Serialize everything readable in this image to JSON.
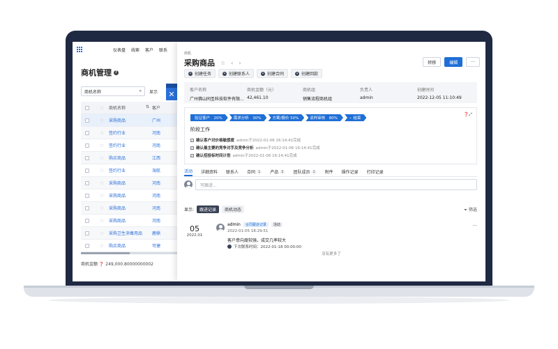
{
  "topnav": {
    "items": [
      "仪表盘",
      "线索",
      "客户",
      "联系"
    ]
  },
  "left": {
    "title": "商机管理",
    "filter_value": "商机名称",
    "show_label": "显示",
    "columns": [
      "商机名称",
      "客户"
    ],
    "rows": [
      {
        "name": "采购商品",
        "customer": "广州"
      },
      {
        "name": "签约行业",
        "customer": "河南"
      },
      {
        "name": "签约行业",
        "customer": "河南"
      },
      {
        "name": "购买商品",
        "customer": "江西"
      },
      {
        "name": "签约行业",
        "customer": "海航"
      },
      {
        "name": "采购商品",
        "customer": "河南"
      },
      {
        "name": "采购商品",
        "customer": "河南"
      },
      {
        "name": "采购商品",
        "customer": "河南"
      },
      {
        "name": "采购商品",
        "customer": "河南"
      },
      {
        "name": "采购卫生消毒用品",
        "customer": "鹿鼎"
      },
      {
        "name": "购买商品",
        "customer": "可捷"
      }
    ],
    "footer": "商机金额 ❓ 249,000.80000000002"
  },
  "detail": {
    "crumb": "商机",
    "title": "采购商品",
    "buttons": {
      "transfer": "转移",
      "edit": "编辑",
      "more": "···"
    },
    "actions": [
      "创建任务",
      "创建联系人",
      "创建合同",
      "创建回款"
    ],
    "info": [
      {
        "label": "客户名称",
        "value": "广州佛山同圣科技软件有限..."
      },
      {
        "label": "商机金额（元）",
        "value": "42,461.10"
      },
      {
        "label": "商机组",
        "value": "销售流程商机组"
      },
      {
        "label": "负责人",
        "value": "admin"
      },
      {
        "label": "创建时间",
        "value": "2022-12-05 11:10:49"
      }
    ],
    "stages": [
      "验证客户　20%",
      "需求分析　30%",
      "方案/报价 50%",
      "谈判审核　80%",
      "结束"
    ],
    "stage_title": "阶段工作",
    "tasks": [
      {
        "text": "确认客户对价格敏感度",
        "meta": "admin于2022-01-06 16:14:41完成"
      },
      {
        "text": "确认最主要的竞争对手及竞争分析",
        "meta": "admin于2022-01-06 16:14:41完成"
      },
      {
        "text": "确认招投标时间计划",
        "meta": "admin于2022-01-06 16:14:41完成"
      }
    ],
    "tabs": [
      {
        "label": "活动",
        "count": ""
      },
      {
        "label": "详细资料",
        "count": ""
      },
      {
        "label": "联系人",
        "count": ""
      },
      {
        "label": "合同",
        "count": "1"
      },
      {
        "label": "产品",
        "count": "3"
      },
      {
        "label": "团队成员",
        "count": "1"
      },
      {
        "label": "附件",
        "count": ""
      },
      {
        "label": "操作记录",
        "count": ""
      },
      {
        "label": "打印记录",
        "count": ""
      }
    ],
    "comment_placeholder": "写跟进...",
    "show_label": "显示:",
    "show_pills": [
      "跟进记录",
      "商机动态"
    ],
    "filter_link": "筛选",
    "entry": {
      "day": "05",
      "ym": "2022.01",
      "user": "admin",
      "tag1": "合同跟进记录",
      "tag2": "活动",
      "time": "2022-01-05 18:29:51",
      "content": "客户意向度较强，成交几率较大",
      "next": "下次联系时间：2022-01-18 00:00:00"
    },
    "no_more": "没有更多了"
  },
  "colors": {
    "accent": "#1f6fd6",
    "bezel": "#202942"
  }
}
